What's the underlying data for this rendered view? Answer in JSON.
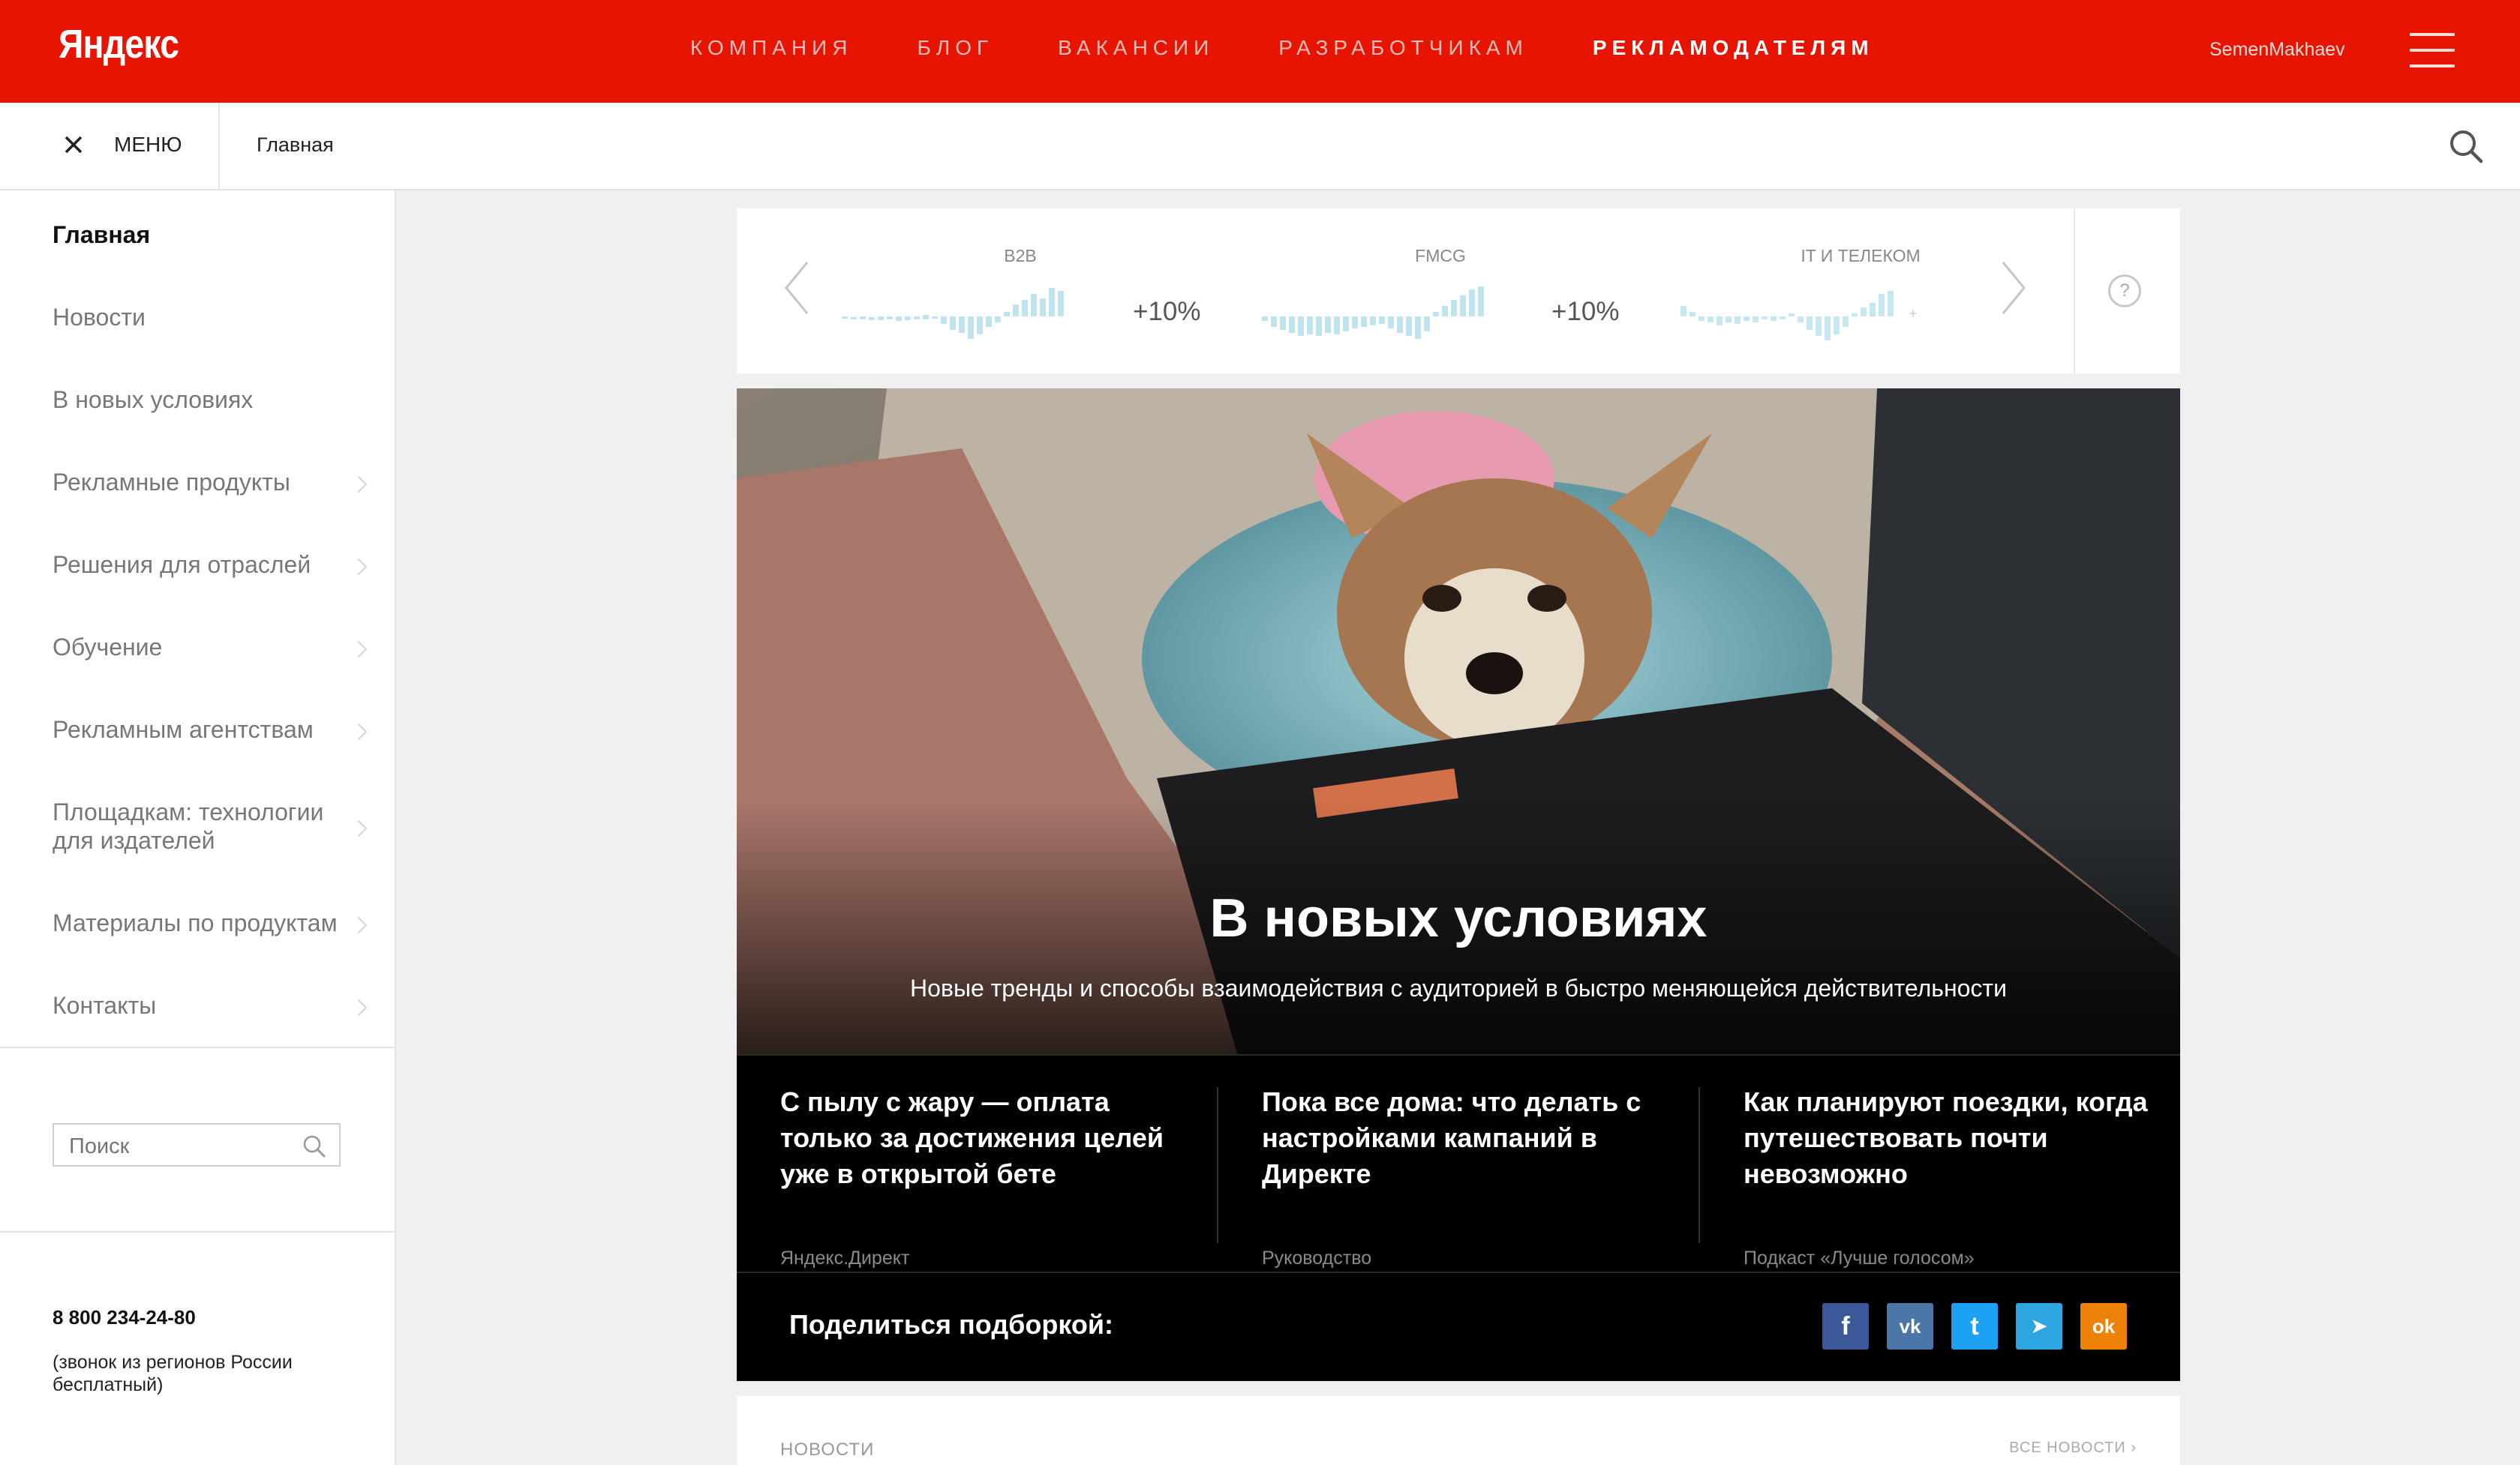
{
  "header": {
    "logo": "Яндекс",
    "nav": [
      "КОМПАНИЯ",
      "БЛОГ",
      "ВАКАНСИИ",
      "РАЗРАБОТЧИКАМ",
      "РЕКЛАМОДАТЕЛЯМ"
    ],
    "active_nav": "РЕКЛАМОДАТЕЛЯМ",
    "username": "SemenMakhaev",
    "brand_color": "#e61400"
  },
  "subbar": {
    "menu_label": "МЕНЮ",
    "breadcrumb": "Главная"
  },
  "sidebar": {
    "items": [
      {
        "label": "Главная",
        "active": true,
        "has_chevron": false
      },
      {
        "label": "Новости",
        "active": false,
        "has_chevron": false
      },
      {
        "label": "В новых условиях",
        "active": false,
        "has_chevron": false
      },
      {
        "label": "Рекламные продукты",
        "active": false,
        "has_chevron": true
      },
      {
        "label": "Решения для отраслей",
        "active": false,
        "has_chevron": true
      },
      {
        "label": "Обучение",
        "active": false,
        "has_chevron": true
      },
      {
        "label": "Рекламным агентствам",
        "active": false,
        "has_chevron": true
      },
      {
        "label": "Площадкам: технологии для издателей",
        "active": false,
        "has_chevron": true
      },
      {
        "label": "Материалы по продуктам",
        "active": false,
        "has_chevron": true
      },
      {
        "label": "Контакты",
        "active": false,
        "has_chevron": true
      }
    ],
    "search_placeholder": "Поиск",
    "phone": "8 800 234-24-80",
    "phone_note": "(звонок из регионов России бесплатный)"
  },
  "ticker": {
    "items": [
      {
        "label": "B2B",
        "change": "+10%"
      },
      {
        "label": "FMCG",
        "change": "+10%"
      },
      {
        "label": "IT И ТЕЛЕКОМ",
        "change": ""
      }
    ],
    "help": "?"
  },
  "hero": {
    "title": "В новых условиях",
    "subtitle": "Новые тренды и способы взаимодействия с аудиторией в быстро меняющейся действительности",
    "cards": [
      {
        "title": "С пылу с жару — оплата только за достижения целей уже в открытой бете",
        "source": "Яндекс.Директ"
      },
      {
        "title": "Пока все дома: что делать с настройками кампаний в Директе",
        "source": "Руководство"
      },
      {
        "title": "Как планируют поездки, когда путешествовать почти невозможно",
        "source": "Подкаст «Лучше голосом»"
      }
    ],
    "share_label": "Поделиться подборкой:",
    "social": [
      {
        "icon": "facebook-icon",
        "glyph": "f",
        "color": "#3b5998"
      },
      {
        "icon": "vk-icon",
        "glyph": "vk",
        "color": "#4a76a8"
      },
      {
        "icon": "twitter-icon",
        "glyph": "t",
        "color": "#1da1f2"
      },
      {
        "icon": "telegram-icon",
        "glyph": "➤",
        "color": "#2ca5e0"
      },
      {
        "icon": "odnoklassniki-icon",
        "glyph": "ok",
        "color": "#ee8208"
      }
    ]
  },
  "news": {
    "label": "НОВОСТИ",
    "all_link": "ВСЕ НОВОСТИ ›"
  }
}
